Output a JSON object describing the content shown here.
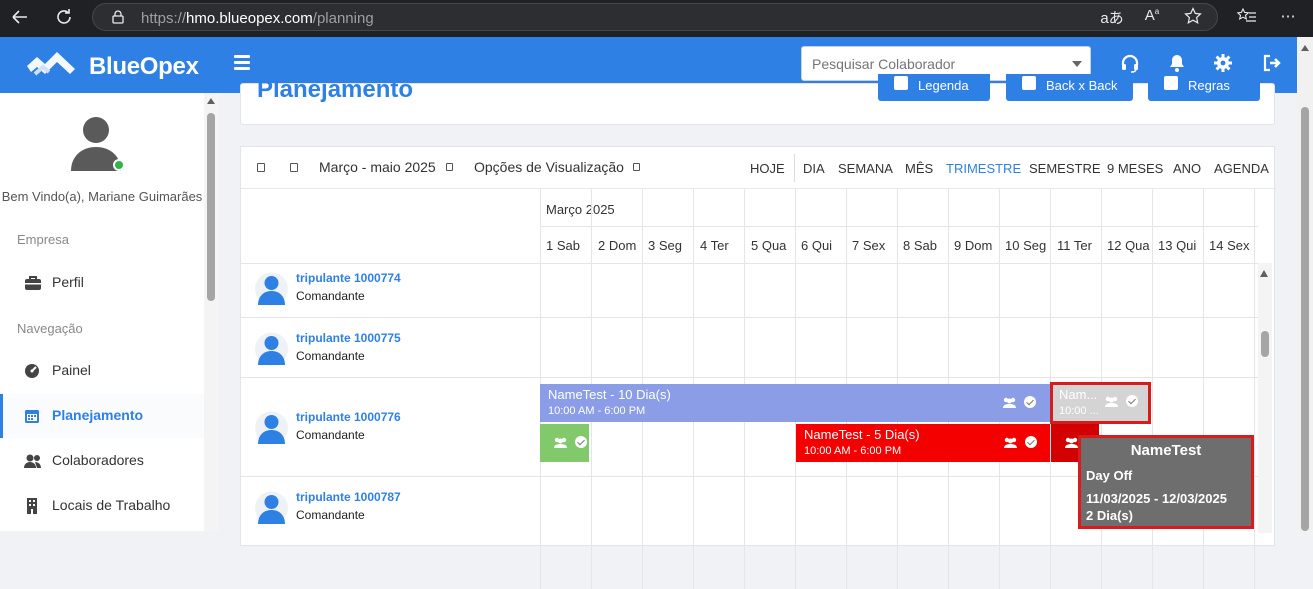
{
  "browser": {
    "url_prefix": "https://",
    "url_host": "hmo.blueopex.com",
    "url_path": "/planning",
    "icons": [
      "back-arrow-icon",
      "refresh-icon",
      "lock-icon",
      "translate-icon",
      "read-aloud-icon",
      "favorite-star-icon",
      "favorites-list-icon"
    ]
  },
  "topnav": {
    "brand": "BlueOpex",
    "search_placeholder": "Pesquisar Colaborador",
    "icons": [
      "headset-icon",
      "bell-icon",
      "gear-icon",
      "logout-icon"
    ]
  },
  "sidebar": {
    "welcome": "Bem Vindo(a), Mariane Guimarães",
    "section_company": "Empresa",
    "section_nav": "Navegação",
    "items": [
      {
        "label": "Perfil",
        "icon": "briefcase-icon"
      },
      {
        "label": "Painel",
        "icon": "dashboard-gauge-icon"
      },
      {
        "label": "Planejamento",
        "icon": "calendar-icon",
        "active": true
      },
      {
        "label": "Colaboradores",
        "icon": "users-icon"
      },
      {
        "label": "Locais de Trabalho",
        "icon": "building-icon"
      }
    ]
  },
  "page": {
    "title": "Planejamento",
    "buttons": [
      "Legenda",
      "Back x Back",
      "Regras"
    ]
  },
  "toolbar": {
    "period": "Março - maio 2025",
    "view_options": "Opções de Visualização",
    "today": "HOJE",
    "views": [
      "DIA",
      "SEMANA",
      "MÊS",
      "TRIMESTRE",
      "SEMESTRE",
      "9 MESES",
      "ANO",
      "AGENDA"
    ],
    "active_view": "TRIMESTRE"
  },
  "calendar": {
    "month": "Março 2025",
    "days": [
      "1 Sab",
      "2 Dom",
      "3 Seg",
      "4 Ter",
      "5 Qua",
      "6 Qui",
      "7 Sex",
      "8 Sab",
      "9 Dom",
      "10 Seg",
      "11 Ter",
      "12 Qua",
      "13 Qui",
      "14 Sex"
    ]
  },
  "crew": [
    {
      "name": "tripulante 1000774",
      "role": "Comandante"
    },
    {
      "name": "tripulante 1000775",
      "role": "Comandante"
    },
    {
      "name": "tripulante 1000776",
      "role": "Comandante"
    },
    {
      "name": "tripulante 1000787",
      "role": "Comandante"
    }
  ],
  "events": [
    {
      "title": "NameTest - 10 Dia(s)",
      "time": "10:00 AM - 6:00 PM",
      "color": "#8a9de6"
    },
    {
      "title": "Nam...",
      "time": "10:00 ...",
      "color": "#d4d4d4"
    },
    {
      "title": "",
      "time": "",
      "color": "#82c96b"
    },
    {
      "title": "NameTest - 5 Dia(s)",
      "time": "10:00 AM - 6:00 PM",
      "color": "#f40000"
    },
    {
      "title": "",
      "time": "",
      "color": "#d30000"
    }
  ],
  "tooltip": {
    "title": "NameTest",
    "type": "Day Off",
    "range": "11/03/2025 - 12/03/2025",
    "duration": "2 Dia(s)"
  },
  "colors": {
    "brand_blue": "#2f80e4",
    "highlight_red": "#d81c1c",
    "tooltip_bg": "#6e6e6e"
  }
}
